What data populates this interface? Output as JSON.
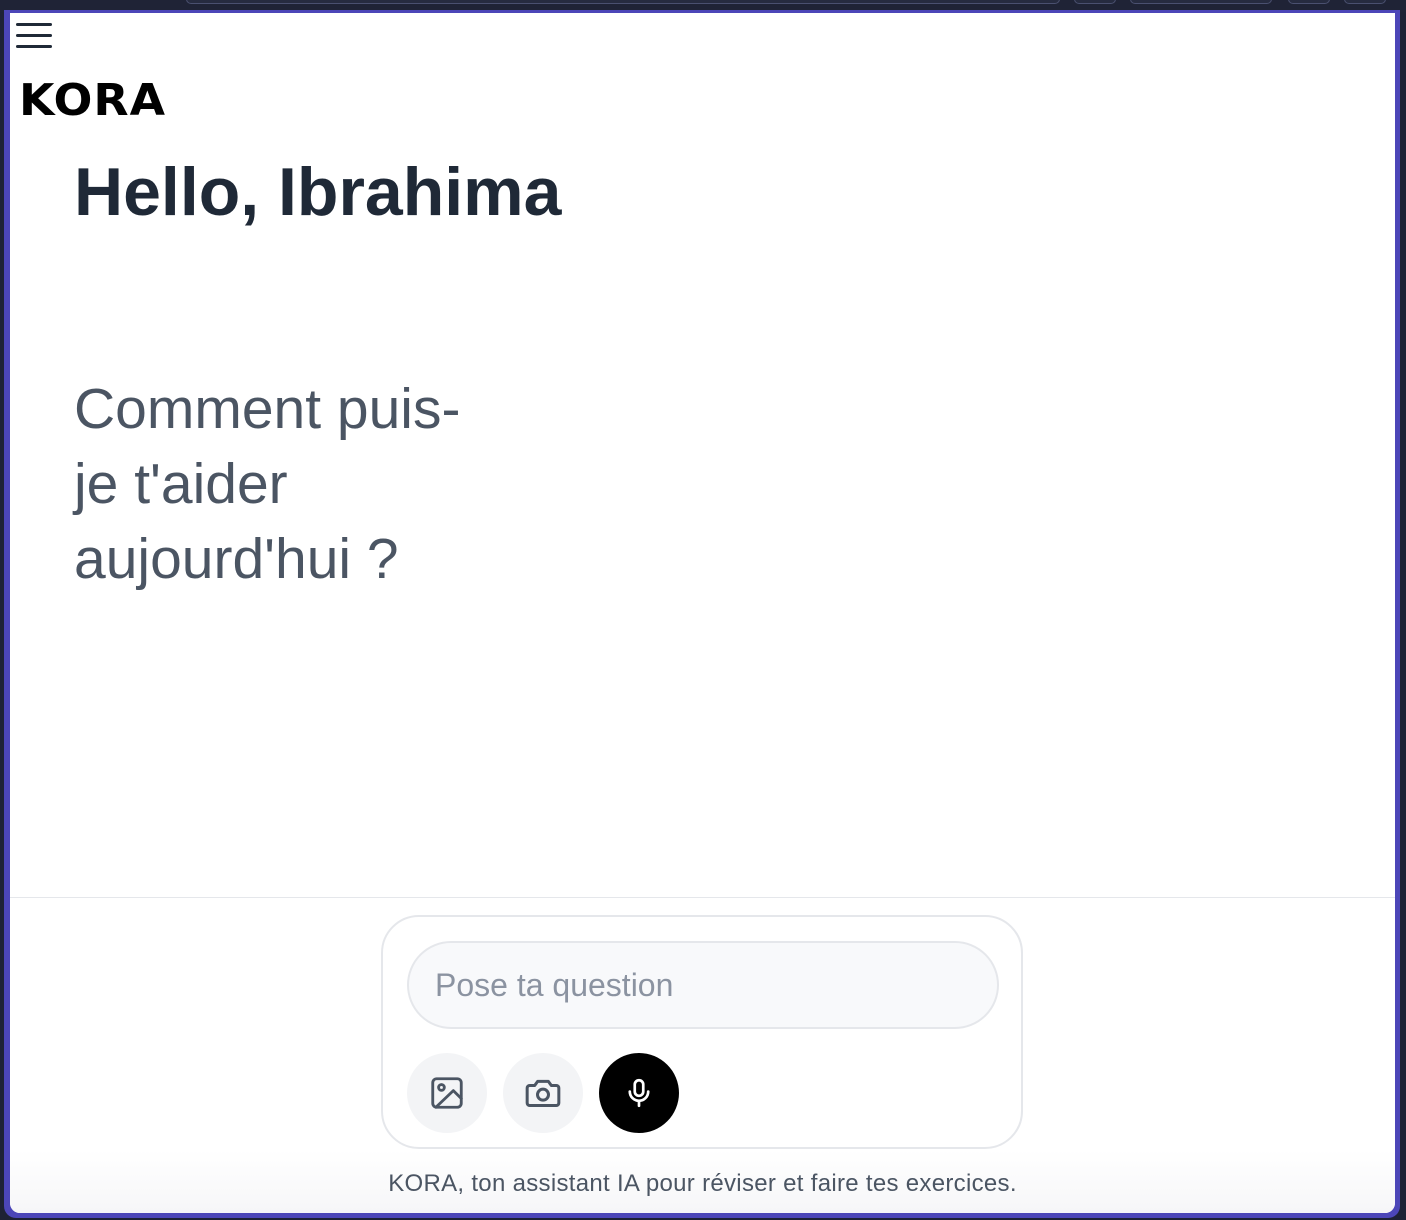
{
  "app": {
    "logo_text": "KORA",
    "menu_icon": "hamburger-menu-icon"
  },
  "main": {
    "greeting": "Hello, Ibrahima",
    "prompt": "Comment puis-je t'aider aujourd'hui ?"
  },
  "composer": {
    "placeholder": "Pose ta question",
    "value": "",
    "buttons": [
      {
        "icon": "image-icon",
        "action": "upload-image"
      },
      {
        "icon": "camera-icon",
        "action": "take-photo"
      },
      {
        "icon": "microphone-icon",
        "action": "voice-input"
      }
    ]
  },
  "footer": {
    "tagline": "KORA, ton assistant IA pour réviser et faire tes exercices."
  },
  "colors": {
    "frame_accent": "#4c46b8",
    "heading": "#1f2937",
    "subtext": "#4b5563",
    "mic_button": "#000000",
    "secondary_button": "#f3f4f6"
  }
}
